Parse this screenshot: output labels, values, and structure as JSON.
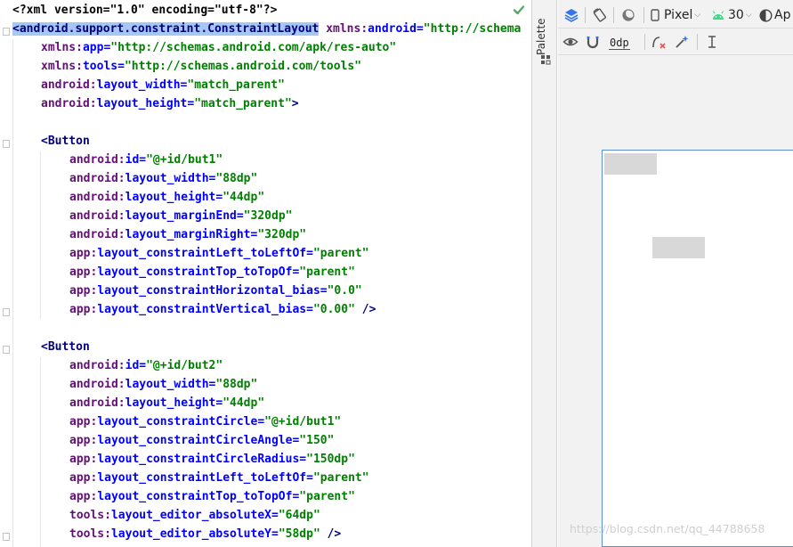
{
  "editor": {
    "lines": [
      {
        "indent": 0,
        "parts": [
          {
            "t": "pi",
            "v": "<?xml version=\"1.0\" encoding=\"utf-8\"?>"
          }
        ]
      },
      {
        "indent": 0,
        "parts": [
          {
            "t": "tag sel",
            "v": "<android.support.constraint.ConstraintLayout"
          },
          {
            "t": "punc",
            "v": " "
          },
          {
            "t": "ns",
            "v": "xmlns:"
          },
          {
            "t": "attr",
            "v": "android"
          },
          {
            "t": "eq",
            "v": "="
          },
          {
            "t": "val",
            "v": "\"http://schema"
          }
        ]
      },
      {
        "indent": 1,
        "parts": [
          {
            "t": "ns",
            "v": "xmlns:"
          },
          {
            "t": "attr",
            "v": "app"
          },
          {
            "t": "eq",
            "v": "="
          },
          {
            "t": "val",
            "v": "\"http://schemas.android.com/apk/res-auto\""
          }
        ]
      },
      {
        "indent": 1,
        "parts": [
          {
            "t": "ns",
            "v": "xmlns:"
          },
          {
            "t": "attr",
            "v": "tools"
          },
          {
            "t": "eq",
            "v": "="
          },
          {
            "t": "val",
            "v": "\"http://schemas.android.com/tools\""
          }
        ]
      },
      {
        "indent": 1,
        "parts": [
          {
            "t": "ns",
            "v": "android:"
          },
          {
            "t": "attr",
            "v": "layout_width"
          },
          {
            "t": "eq",
            "v": "="
          },
          {
            "t": "val",
            "v": "\"match_parent\""
          }
        ]
      },
      {
        "indent": 1,
        "parts": [
          {
            "t": "ns",
            "v": "android:"
          },
          {
            "t": "attr",
            "v": "layout_height"
          },
          {
            "t": "eq",
            "v": "="
          },
          {
            "t": "val",
            "v": "\"match_parent\""
          },
          {
            "t": "tag",
            "v": ">"
          }
        ]
      },
      {
        "indent": 0,
        "parts": []
      },
      {
        "indent": 1,
        "parts": [
          {
            "t": "tag",
            "v": "<Button"
          }
        ]
      },
      {
        "indent": 2,
        "parts": [
          {
            "t": "ns",
            "v": "android:"
          },
          {
            "t": "attr",
            "v": "id"
          },
          {
            "t": "eq",
            "v": "="
          },
          {
            "t": "val",
            "v": "\"@+id/but1\""
          }
        ]
      },
      {
        "indent": 2,
        "parts": [
          {
            "t": "ns",
            "v": "android:"
          },
          {
            "t": "attr",
            "v": "layout_width"
          },
          {
            "t": "eq",
            "v": "="
          },
          {
            "t": "val",
            "v": "\"88dp\""
          }
        ]
      },
      {
        "indent": 2,
        "parts": [
          {
            "t": "ns",
            "v": "android:"
          },
          {
            "t": "attr",
            "v": "layout_height"
          },
          {
            "t": "eq",
            "v": "="
          },
          {
            "t": "val",
            "v": "\"44dp\""
          }
        ]
      },
      {
        "indent": 2,
        "parts": [
          {
            "t": "ns",
            "v": "android:"
          },
          {
            "t": "attr",
            "v": "layout_marginEnd"
          },
          {
            "t": "eq",
            "v": "="
          },
          {
            "t": "val",
            "v": "\"320dp\""
          }
        ]
      },
      {
        "indent": 2,
        "parts": [
          {
            "t": "ns",
            "v": "android:"
          },
          {
            "t": "attr",
            "v": "layout_marginRight"
          },
          {
            "t": "eq",
            "v": "="
          },
          {
            "t": "val",
            "v": "\"320dp\""
          }
        ]
      },
      {
        "indent": 2,
        "parts": [
          {
            "t": "ns",
            "v": "app:"
          },
          {
            "t": "attr",
            "v": "layout_constraintLeft_toLeftOf"
          },
          {
            "t": "eq",
            "v": "="
          },
          {
            "t": "val",
            "v": "\"parent\""
          }
        ]
      },
      {
        "indent": 2,
        "parts": [
          {
            "t": "ns",
            "v": "app:"
          },
          {
            "t": "attr",
            "v": "layout_constraintTop_toTopOf"
          },
          {
            "t": "eq",
            "v": "="
          },
          {
            "t": "val",
            "v": "\"parent\""
          }
        ]
      },
      {
        "indent": 2,
        "parts": [
          {
            "t": "ns",
            "v": "app:"
          },
          {
            "t": "attr",
            "v": "layout_constraintHorizontal_bias"
          },
          {
            "t": "eq",
            "v": "="
          },
          {
            "t": "val",
            "v": "\"0.0\""
          }
        ]
      },
      {
        "indent": 2,
        "parts": [
          {
            "t": "ns",
            "v": "app:"
          },
          {
            "t": "attr",
            "v": "layout_constraintVertical_bias"
          },
          {
            "t": "eq",
            "v": "="
          },
          {
            "t": "val",
            "v": "\"0.00\""
          },
          {
            "t": "tag",
            "v": " />"
          }
        ]
      },
      {
        "indent": 0,
        "parts": []
      },
      {
        "indent": 1,
        "parts": [
          {
            "t": "tag",
            "v": "<Button"
          }
        ]
      },
      {
        "indent": 2,
        "parts": [
          {
            "t": "ns",
            "v": "android:"
          },
          {
            "t": "attr",
            "v": "id"
          },
          {
            "t": "eq",
            "v": "="
          },
          {
            "t": "val",
            "v": "\"@+id/but2\""
          }
        ]
      },
      {
        "indent": 2,
        "parts": [
          {
            "t": "ns",
            "v": "android:"
          },
          {
            "t": "attr",
            "v": "layout_width"
          },
          {
            "t": "eq",
            "v": "="
          },
          {
            "t": "val",
            "v": "\"88dp\""
          }
        ]
      },
      {
        "indent": 2,
        "parts": [
          {
            "t": "ns",
            "v": "android:"
          },
          {
            "t": "attr",
            "v": "layout_height"
          },
          {
            "t": "eq",
            "v": "="
          },
          {
            "t": "val",
            "v": "\"44dp\""
          }
        ]
      },
      {
        "indent": 2,
        "parts": [
          {
            "t": "ns",
            "v": "app:"
          },
          {
            "t": "attr",
            "v": "layout_constraintCircle"
          },
          {
            "t": "eq",
            "v": "="
          },
          {
            "t": "val",
            "v": "\"@+id/but1\""
          }
        ]
      },
      {
        "indent": 2,
        "parts": [
          {
            "t": "ns",
            "v": "app:"
          },
          {
            "t": "attr",
            "v": "layout_constraintCircleAngle"
          },
          {
            "t": "eq",
            "v": "="
          },
          {
            "t": "val",
            "v": "\"150\""
          }
        ]
      },
      {
        "indent": 2,
        "parts": [
          {
            "t": "ns",
            "v": "app:"
          },
          {
            "t": "attr",
            "v": "layout_constraintCircleRadius"
          },
          {
            "t": "eq",
            "v": "="
          },
          {
            "t": "val",
            "v": "\"150dp\""
          }
        ]
      },
      {
        "indent": 2,
        "parts": [
          {
            "t": "ns",
            "v": "app:"
          },
          {
            "t": "attr",
            "v": "layout_constraintLeft_toLeftOf"
          },
          {
            "t": "eq",
            "v": "="
          },
          {
            "t": "val",
            "v": "\"parent\""
          }
        ]
      },
      {
        "indent": 2,
        "parts": [
          {
            "t": "ns",
            "v": "app:"
          },
          {
            "t": "attr",
            "v": "layout_constraintTop_toTopOf"
          },
          {
            "t": "eq",
            "v": "="
          },
          {
            "t": "val",
            "v": "\"parent\""
          }
        ]
      },
      {
        "indent": 2,
        "parts": [
          {
            "t": "ns",
            "v": "tools:"
          },
          {
            "t": "attr",
            "v": "layout_editor_absoluteX"
          },
          {
            "t": "eq",
            "v": "="
          },
          {
            "t": "val",
            "v": "\"64dp\""
          }
        ]
      },
      {
        "indent": 2,
        "parts": [
          {
            "t": "ns",
            "v": "tools:"
          },
          {
            "t": "attr",
            "v": "layout_editor_absoluteY"
          },
          {
            "t": "eq",
            "v": "="
          },
          {
            "t": "val",
            "v": "\"58dp\""
          },
          {
            "t": "tag",
            "v": " />"
          }
        ]
      }
    ],
    "status_icon": "check-icon",
    "status_color": "#59a869"
  },
  "palette": {
    "label": "Palette"
  },
  "design_toolbar": {
    "device": "Pixel",
    "api_level": "30",
    "theme": "Ap",
    "margin_value": "0dp",
    "icons": [
      "layers-icon",
      "orientation-icon",
      "night-mode-icon",
      "device-icon",
      "android-icon",
      "theme-icon",
      "eye-icon",
      "magnet-icon",
      "clear-constraints-icon",
      "infer-constraints-icon",
      "align-icon"
    ]
  },
  "design_canvas": {
    "accent": "#5a8fd6",
    "button_color": "#d8d8d8"
  },
  "watermark": {
    "text": "https://blog.csdn.net/qq_44788658"
  }
}
